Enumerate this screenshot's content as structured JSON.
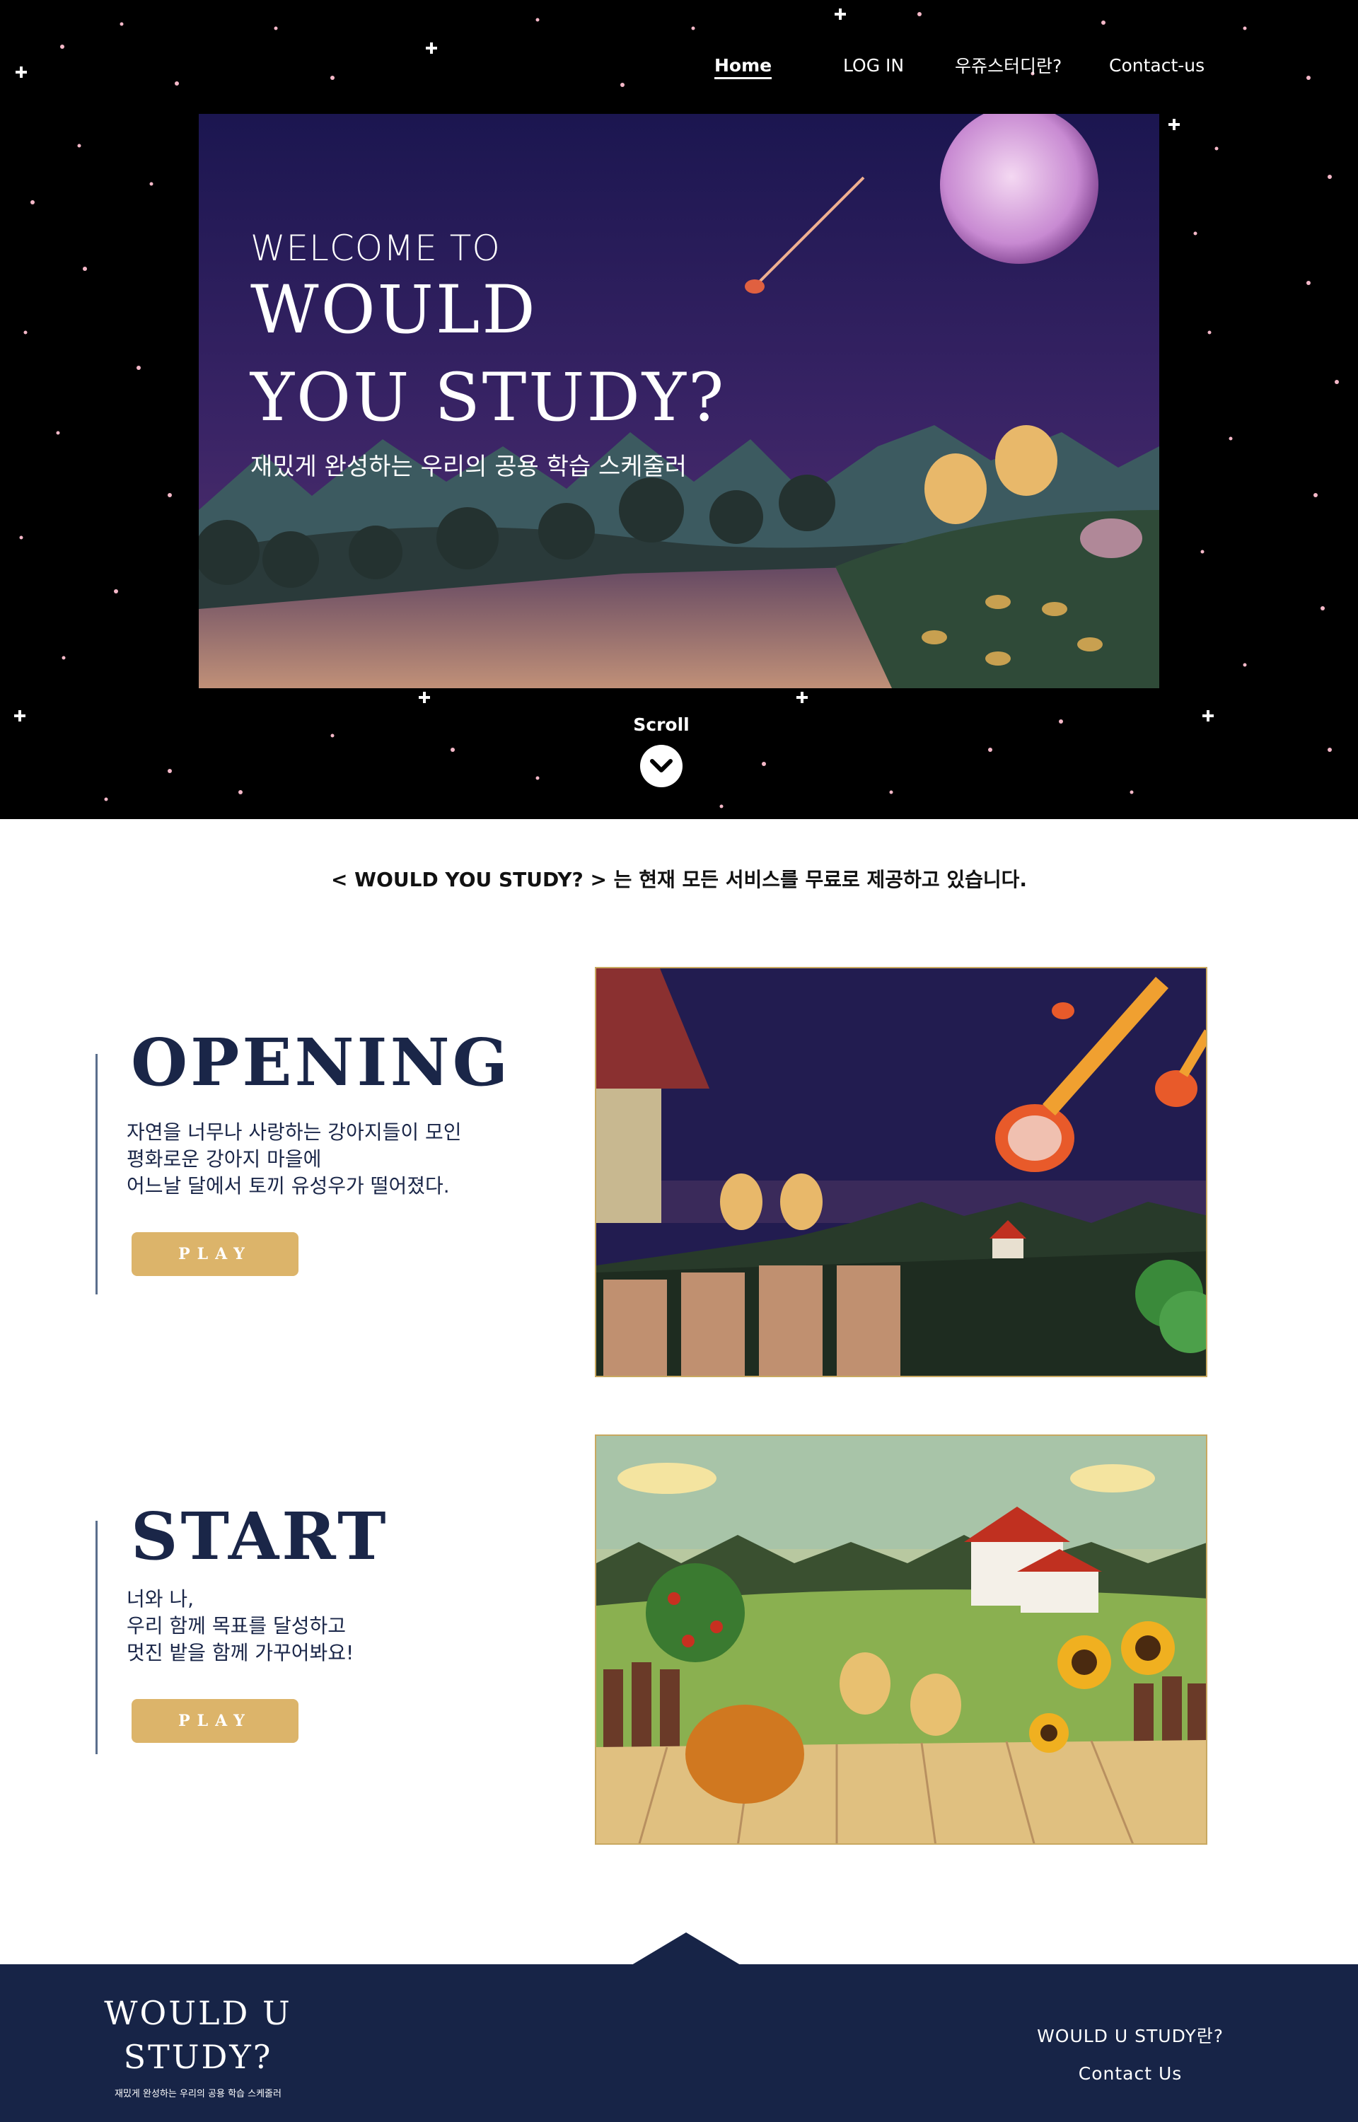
{
  "nav": {
    "home": "Home",
    "login": "LOG IN",
    "about": "우쥬스터디란?",
    "contact": "Contact-us"
  },
  "hero": {
    "welcome": "WELCOME TO",
    "brand_line1": "WOULD",
    "brand_line2": "YOU STUDY?",
    "subtitle": "재밌게 완성하는 우리의 공용 학습 스케줄러"
  },
  "scroll": {
    "label": "Scroll",
    "icon": "chevron-down-icon"
  },
  "notice": "< WOULD YOU STUDY? > 는 현재 모든 서비스를 무료로 제공하고 있습니다.",
  "sections": [
    {
      "title": "OPENING",
      "lines": [
        "자연을 너무나 사랑하는 강아지들이 모인",
        "평화로운 강아지 마을에",
        "어느날 달에서 토끼 유성우가 떨어졌다."
      ],
      "button": "PLAY"
    },
    {
      "title": "START",
      "lines": [
        "너와 나,",
        "우리 함께 목표를 달성하고",
        "멋진 밭을 함께 가꾸어봐요!"
      ],
      "button": "PLAY"
    }
  ],
  "footer": {
    "logo_line1": "WOULD U",
    "logo_line2": "STUDY?",
    "tagline": "재밌게 완성하는 우리의 공용 학습 스케줄러",
    "about_link": "WOULD U STUDY란?",
    "contact_link": "Contact Us"
  },
  "colors": {
    "navy": "#172447",
    "play_button": "#dcb46a",
    "hero_background": "#000000"
  }
}
